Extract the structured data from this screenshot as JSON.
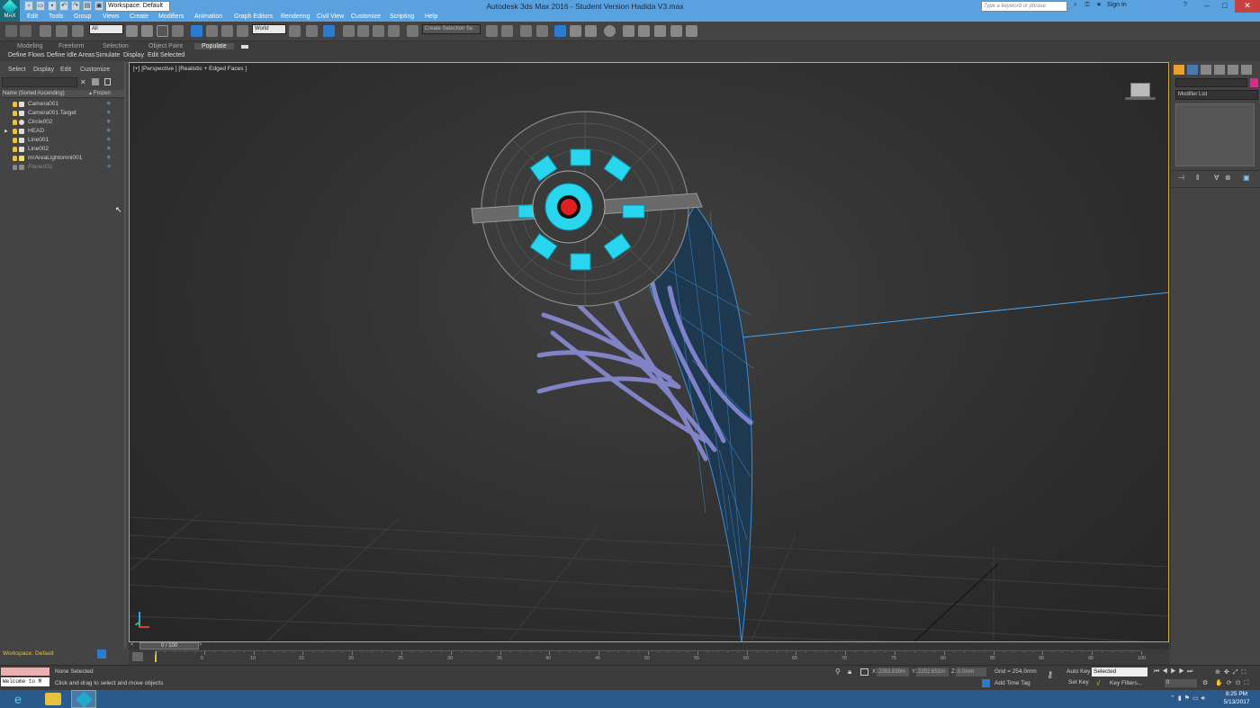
{
  "window": {
    "title": "Autodesk 3ds Max 2016 - Student Version    Hadida V3.max",
    "app_badge": "MAX",
    "workspace": "Workspace: Default",
    "search_placeholder": "Type a keyword or phrase",
    "sign_in": "Sign In"
  },
  "menu": [
    "Edit",
    "Tools",
    "Group",
    "Views",
    "Create",
    "Modifiers",
    "Animation",
    "Graph Editors",
    "Rendering",
    "Civil View",
    "Customize",
    "Scripting",
    "Help"
  ],
  "toolbar": {
    "filter": "All",
    "ref_coord": "World",
    "named_selection": "Create Selection Se"
  },
  "ribbon": {
    "tabs": [
      "Modeling",
      "Freeform",
      "Selection",
      "Object Paint",
      "Populate"
    ],
    "active_tab": "Populate",
    "buttons": [
      "Define Flows",
      "Define Idle Areas",
      "Simulate",
      "Display",
      "Edit Selected"
    ]
  },
  "explorer": {
    "tabs": [
      "Select",
      "Display",
      "Edit",
      "Customize"
    ],
    "col_name": "Name (Sorted Ascending)",
    "col_frozen": "Frozen",
    "rows": [
      "Camera001",
      "Camera001.Target",
      "Circle002",
      "HEAD",
      "Line001",
      "Line002",
      "mrAreaLightomni001",
      "Plane001"
    ]
  },
  "viewport": {
    "label": "[+] [Perspective ] [Realistic + Edged Faces ]"
  },
  "cmdpanel": {
    "modifier_list": "Modifier List",
    "color_swatch": "#e0288c"
  },
  "timeline": {
    "frame": "0 / 100",
    "ticks": [
      "0",
      "5",
      "10",
      "15",
      "20",
      "25",
      "30",
      "35",
      "40",
      "45",
      "50",
      "55",
      "60",
      "65",
      "70",
      "75",
      "80",
      "85",
      "90",
      "95",
      "100"
    ]
  },
  "status": {
    "workspace": "Workspace: Default",
    "listener": "Welcome to M",
    "selection": "None Selected",
    "prompt": "Click and drag to select and move objects",
    "x_label": "X:",
    "x": "2263.839m",
    "y_label": "Y:",
    "y": "2202.651m",
    "z_label": "Z:",
    "z": "0.0mm",
    "grid": "Grid = 254.0mm",
    "add_time_tag": "Add Time Tag",
    "auto_key": "Auto Key",
    "set_key": "Set Key",
    "key_mode": "Selected",
    "key_filters": "Key Filters...",
    "frame": "0"
  },
  "taskbar": {
    "time": "8:25 PM",
    "date": "5/13/2017"
  }
}
